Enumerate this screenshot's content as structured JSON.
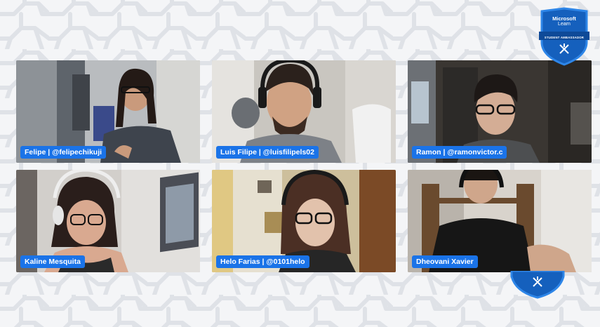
{
  "badge": {
    "line1": "Microsoft",
    "line2": "Learn",
    "line3": "STUDENT AMBASSADOR",
    "color": "#1560bd",
    "border_color": "#2e86e8"
  },
  "participants": [
    {
      "name_label": "Felipe | @felipechikuji"
    },
    {
      "name_label": "Luis Filipe | @luisfilipels02"
    },
    {
      "name_label": "Ramon | @ramonvictor.c"
    },
    {
      "name_label": "Kaline Mesquita"
    },
    {
      "name_label": "Helo Farias | @0101helo"
    },
    {
      "name_label": "Dheovani Xavier"
    }
  ],
  "colors": {
    "name_tag_bg": "#1a73e8",
    "background": "#f4f5f7"
  }
}
